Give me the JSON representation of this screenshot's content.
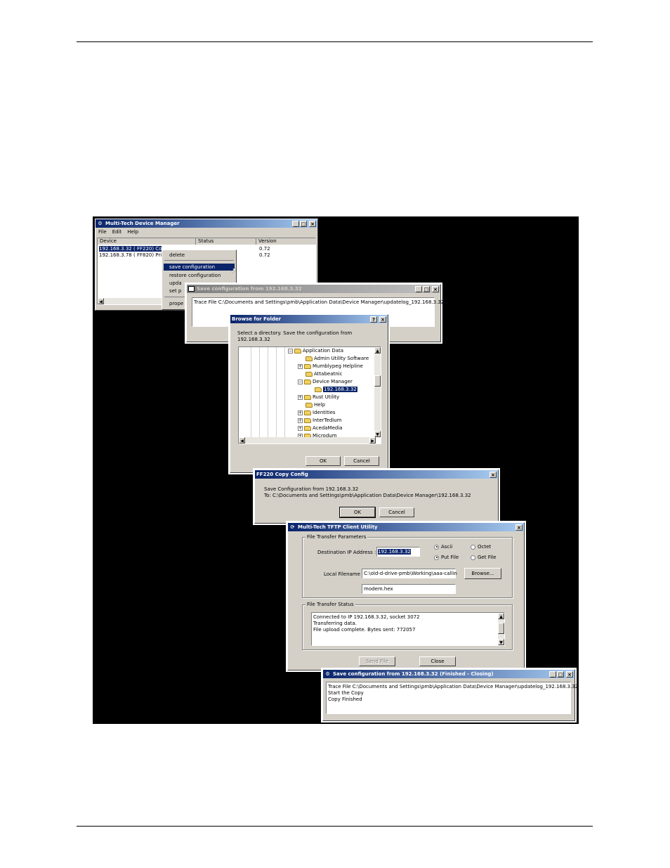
{
  "device_manager": {
    "title": "Multi-Tech Device Manager",
    "menu": [
      "File",
      "Edit",
      "Help"
    ],
    "columns": [
      "Device",
      "Status",
      "Version"
    ],
    "rows": [
      {
        "device": "192.168.3.32 ( FF220) Co",
        "version": "0.72"
      },
      {
        "device": "192.168.3.78 ( FF820) Prin",
        "version": "0.72"
      }
    ],
    "context_menu": [
      "delete",
      "save configuration",
      "restore configuration",
      "upda",
      "set p",
      "prope"
    ]
  },
  "save_config_window": {
    "title": "Save configuration from 192.168.3.32",
    "log": "Trace File C:\\Documents and Settings\\pmb\\Application Data\\Device Manager\\updatelog_192.168.3.32"
  },
  "browse_folder": {
    "title": "Browse for Folder",
    "prompt_line1": "Select a directory.  Save the configuration from",
    "prompt_line2": "192.168.3.32",
    "tree": [
      {
        "label": "Application Data",
        "expander": "−"
      },
      {
        "label": "Admin Utility Software",
        "expander": ""
      },
      {
        "label": "Mumblypeg Helpline",
        "expander": "+"
      },
      {
        "label": "Attabeatnic",
        "expander": ""
      },
      {
        "label": "Device Manager",
        "expander": "−"
      },
      {
        "label": "192.168.3.32",
        "expander": ""
      },
      {
        "label": "Rust Utility",
        "expander": "+"
      },
      {
        "label": "Help",
        "expander": ""
      },
      {
        "label": "Identities",
        "expander": "+"
      },
      {
        "label": "InterTedium",
        "expander": "+"
      },
      {
        "label": "AcedaMedia",
        "expander": "+"
      },
      {
        "label": "Microdum",
        "expander": "+"
      }
    ],
    "ok_label": "OK",
    "cancel_label": "Cancel"
  },
  "copy_config": {
    "title": "FF220 Copy Config",
    "line1": "Save Configuration from 192.168.3.32",
    "line2": "To: C:\\Documents and Settings\\pmb\\Application Data\\Device Manager\\192.168.3.32",
    "ok_label": "OK",
    "cancel_label": "Cancel"
  },
  "tftp": {
    "title": "Multi-Tech TFTP Client Utility",
    "params_legend": "File Transfer Parameters",
    "dest_ip_label": "Destination IP Address :",
    "dest_ip_value": "192.168.3.32",
    "ascii_label": "Ascii",
    "octet_label": "Octet",
    "put_label": "Put File",
    "get_label": "Get File",
    "local_label": "Local Filename",
    "local_value": "C:\\old-d-drive-pmb\\Working\\aaa-callin",
    "file_value": "modem.hex",
    "browse_label": "Browse...",
    "status_legend": "File Transfer Status",
    "status_lines": [
      "Connected to IP 192.168.3.32, socket 3072",
      "Transferring data.",
      "File upload complete. Bytes sent: 772057"
    ],
    "send_label": "Send File",
    "close_label": "Close"
  },
  "finished_window": {
    "title": "Save configuration from 192.168.3.32 (Finished - Closing)",
    "lines": [
      "Trace File C:\\Documents and Settings\\pmb\\Application Data\\Device Manager\\updatelog_192.168.3.32",
      "Start the Copy",
      "Copy Finished"
    ]
  }
}
